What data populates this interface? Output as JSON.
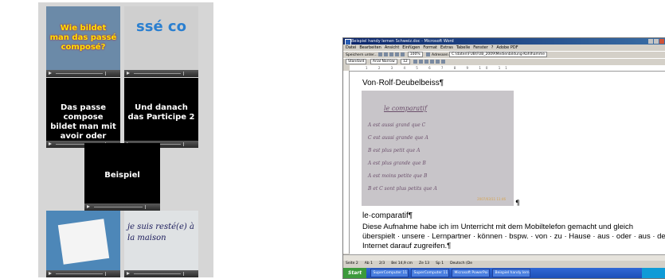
{
  "storyboard": {
    "tiles": [
      {
        "caption": "Wie bildet man das passé composé?"
      },
      {
        "caption": "ssé co"
      },
      {
        "caption": "Das passe compose bildet man mit avoir oder etre."
      },
      {
        "caption": "Und danach das Participe 2"
      },
      {
        "caption": "Beispiel"
      },
      {
        "caption": ""
      },
      {
        "caption": "je suis resté(e) à la maison"
      }
    ]
  },
  "word": {
    "title": "Beispiel handy lernen Schweiz.doc - Microsoft Word",
    "menu": [
      "Datei",
      "Bearbeiten",
      "Ansicht",
      "Einfügen",
      "Format",
      "Extras",
      "Tabelle",
      "Fenster",
      "?",
      "Adobe PDF"
    ],
    "toolbar1_label": "Speichern unter...",
    "zoom": "100%",
    "address_label": "Adressen",
    "path": "C:\\daten\\FUB\\FUB_2009\\Medienbildung-Kohlhamme",
    "style_box": "Standard",
    "font_box": "Arial Narrow",
    "size_box": "12",
    "author_line": "Von·Rolf·Deubelbeiss¶",
    "photo_lines": [
      "le comparatif",
      "A est aussi grand que C",
      "C est aussi grande que A",
      "B est plus petit que A",
      "A est plus grande que B",
      "A est moins petite que B",
      "B et C sont plus petits que A"
    ],
    "photo_timestamp": "2007/03/11 11:46",
    "photo_pilcrow": "¶",
    "heading": "le·comparatif¶",
    "heading_underlined": "comparatif",
    "body_lines": [
      "Diese Aufnahme habe ich im Unterricht mit dem Mobiltelefon gemacht und gleich",
      "überspielt · unsere · Lernpartner · können · bspw. · von · zu · Hause · aus · oder · aus · de",
      "Internet darauf zugreifen.¶"
    ],
    "status": [
      "Seite 2",
      "Ab 1",
      "2/3",
      "Bei 14,9 cm",
      "Ze 13",
      "Sp 1",
      "Deutsch (De"
    ],
    "taskbar": {
      "start_label": "Start",
      "tasks": [
        "SuperComputer 11",
        "SuperComputer 11",
        "Microsoft PowerPoi",
        "Beispiel handy lern"
      ]
    }
  }
}
